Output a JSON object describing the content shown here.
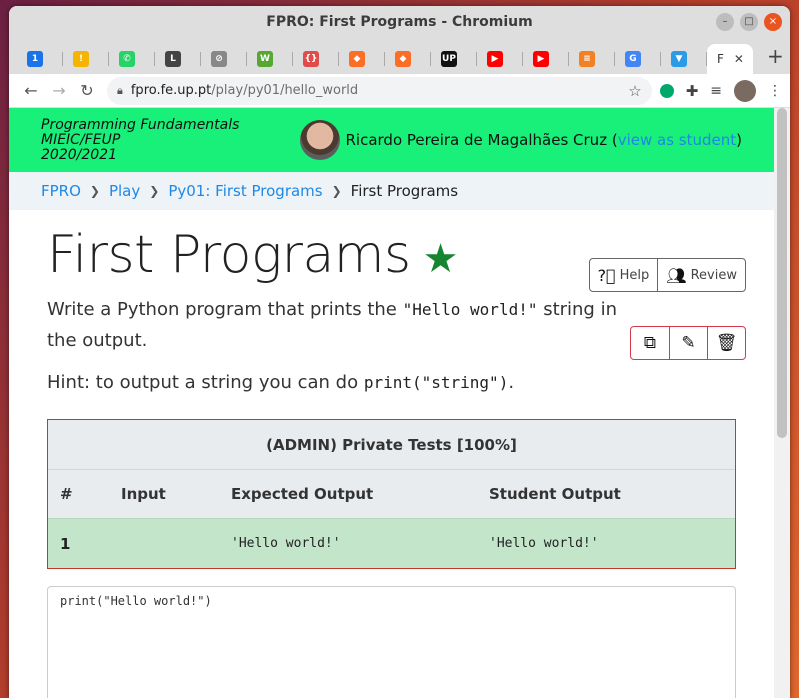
{
  "window": {
    "title": "FPRO: First Programs - Chromium",
    "controls": [
      "–",
      "□",
      "×"
    ]
  },
  "tabs": [
    {
      "icon": "calendar-icon",
      "color": "#1a73e8",
      "glyph": "1"
    },
    {
      "icon": "keep-icon",
      "color": "#f4b400",
      "glyph": "!"
    },
    {
      "icon": "whatsapp-icon",
      "color": "#25d366",
      "glyph": "✆"
    },
    {
      "icon": "l-icon",
      "color": "#444444",
      "glyph": "L"
    },
    {
      "icon": "globe-icon",
      "color": "#888888",
      "glyph": "⊘"
    },
    {
      "icon": "w-icon",
      "color": "#56a832",
      "glyph": "W"
    },
    {
      "icon": "braces-icon",
      "color": "#e04c4c",
      "glyph": "{}"
    },
    {
      "icon": "gitlab-icon",
      "color": "#fc6d26",
      "glyph": "◆"
    },
    {
      "icon": "gitlab-icon",
      "color": "#fc6d26",
      "glyph": "◆"
    },
    {
      "icon": "up-icon",
      "color": "#111111",
      "glyph": "UP"
    },
    {
      "icon": "youtube-icon",
      "color": "#ff0000",
      "glyph": "▶"
    },
    {
      "icon": "youtube-icon",
      "color": "#ff0000",
      "glyph": "▶"
    },
    {
      "icon": "stackoverflow-icon",
      "color": "#f48024",
      "glyph": "≡"
    },
    {
      "icon": "google-icon",
      "color": "#4285f4",
      "glyph": "G"
    },
    {
      "icon": "arrow-down-icon",
      "color": "#2b9be8",
      "glyph": "▼"
    }
  ],
  "active_tab": {
    "label": "F"
  },
  "address": {
    "host": "fpro.fe.up.pt",
    "path": "/play/py01/hello_world"
  },
  "banner": {
    "course_line1": "Programming Fundamentals",
    "course_line2": "MIEIC/FEUP",
    "course_line3": "2020/2021",
    "user_name": "Ricardo Pereira de Magalhães Cruz",
    "view_as_open": "(",
    "view_as_link": "view as student",
    "view_as_close": ")"
  },
  "breadcrumb": {
    "items": [
      "FPRO",
      "Play",
      "Py01: First Programs"
    ],
    "current": "First Programs"
  },
  "problem": {
    "title": "First Programs",
    "star": "★",
    "help_label": "Help",
    "review_label": "Review",
    "desc_before": "Write a Python program that prints the ",
    "desc_code": "\"Hello world!\"",
    "desc_after": " string in the output.",
    "hint_before": "Hint: to output a string you can do ",
    "hint_code": "print(\"string\")",
    "hint_after": "."
  },
  "tests": {
    "title": "(ADMIN) Private Tests [100%]",
    "columns": [
      "#",
      "Input",
      "Expected Output",
      "Student Output"
    ],
    "rows": [
      {
        "num": "1",
        "input": "",
        "expected": "'Hello world!'",
        "student": "'Hello world!'"
      }
    ]
  },
  "editor": {
    "code": "print(\"Hello world!\")"
  }
}
